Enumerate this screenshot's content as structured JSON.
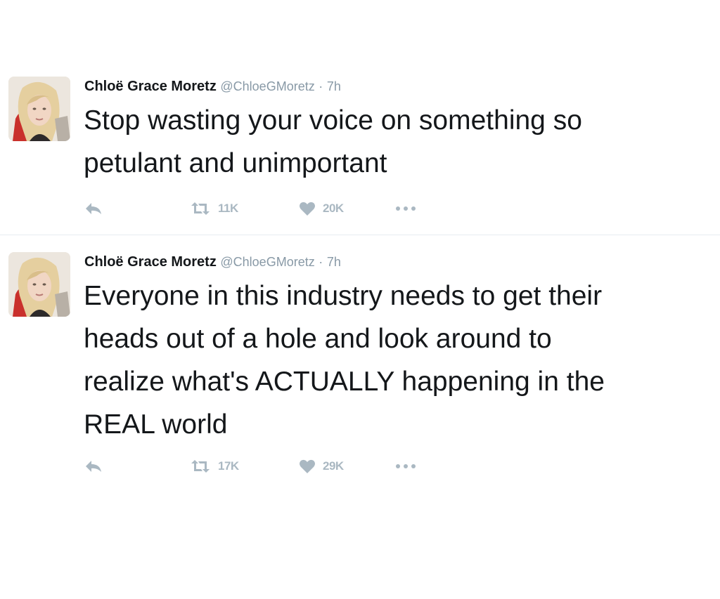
{
  "tweets": [
    {
      "name": "Chloë Grace Moretz",
      "handle": "@ChloeGMoretz",
      "separator": "·",
      "time": "7h",
      "text": "Stop wasting your voice on something so\npetulant and unimportant",
      "retweets": "11K",
      "likes": "20K",
      "icons": [
        "reply-icon",
        "retweet-icon",
        "heart-icon",
        "more-icon"
      ]
    },
    {
      "name": "Chloë Grace Moretz",
      "handle": "@ChloeGMoretz",
      "separator": "·",
      "time": "7h",
      "text": "Everyone in this industry needs to get their\nheads out of a hole and look around to\nrealize what's ACTUALLY happening in the\nREAL world",
      "retweets": "17K",
      "likes": "29K",
      "icons": [
        "reply-icon",
        "retweet-icon",
        "heart-icon",
        "more-icon"
      ]
    }
  ],
  "colors": {
    "text": "#14171a",
    "muted": "#8899a6",
    "icon": "#aab8c2",
    "divider": "#e6ecf0"
  }
}
